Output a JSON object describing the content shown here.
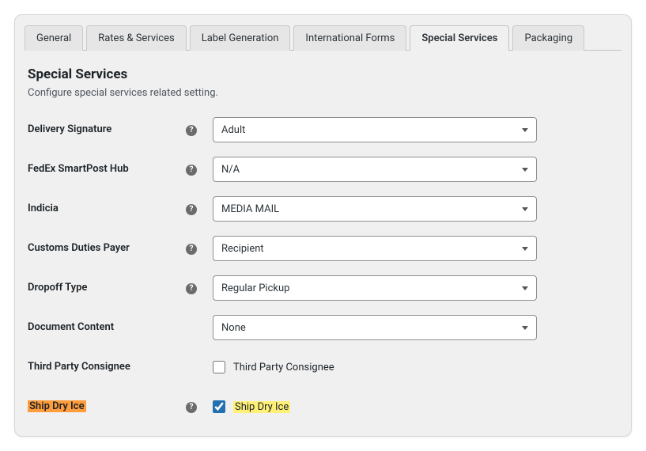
{
  "tabs": {
    "general": "General",
    "rates": "Rates & Services",
    "label": "Label Generation",
    "intl": "International Forms",
    "special": "Special Services",
    "packaging": "Packaging"
  },
  "section": {
    "title": "Special Services",
    "desc": "Configure special services related setting."
  },
  "help_glyph": "?",
  "fields": {
    "delivery_signature": {
      "label": "Delivery Signature",
      "value": "Adult"
    },
    "smartpost_hub": {
      "label": "FedEx SmartPost Hub",
      "value": "N/A"
    },
    "indicia": {
      "label": "Indicia",
      "value": "MEDIA MAIL"
    },
    "customs_payer": {
      "label": "Customs Duties Payer",
      "value": "Recipient"
    },
    "dropoff_type": {
      "label": "Dropoff Type",
      "value": "Regular Pickup"
    },
    "document_content": {
      "label": "Document Content",
      "value": "None"
    },
    "third_party_consignee": {
      "label": "Third Party Consignee",
      "checkbox_label": "Third Party Consignee"
    },
    "ship_dry_ice": {
      "label": "Ship Dry Ice",
      "checkbox_label": "Ship Dry Ice"
    }
  }
}
